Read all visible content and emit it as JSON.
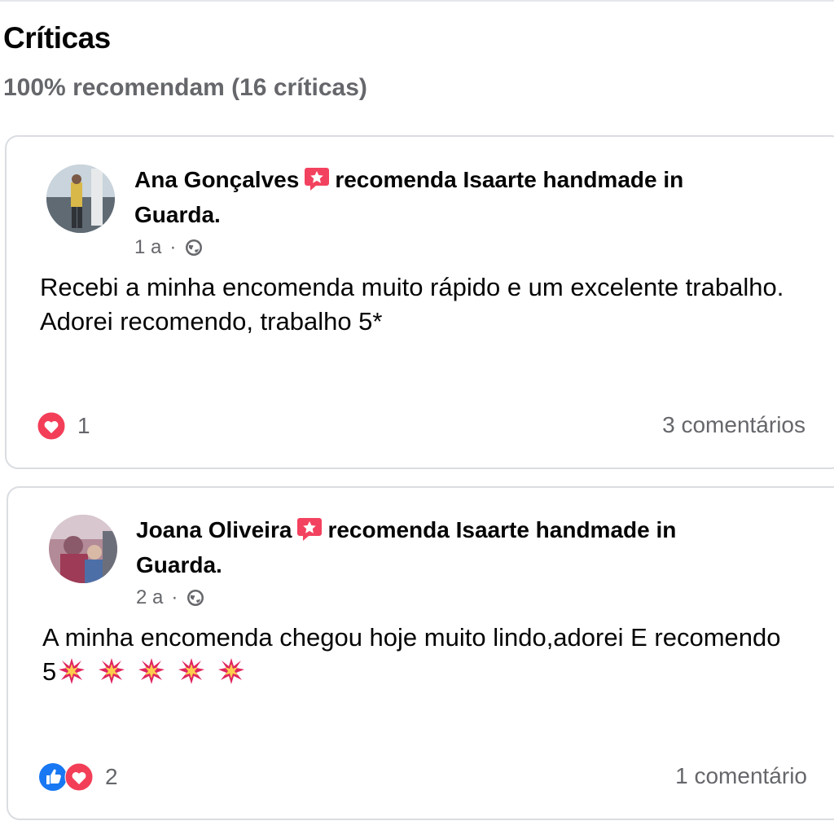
{
  "header": {
    "title": "Críticas",
    "summary": "100% recomendam (16 críticas)"
  },
  "reviews": [
    {
      "author": "Ana Gonçalves",
      "action": "recomenda Isaarte handmade in Guarda.",
      "time": "1 a",
      "separator": "·",
      "privacy_icon": "globe-icon",
      "text": "Recebi a minha encomenda muito rápido e um excelente trabalho. Adorei recomendo, trabalho 5*",
      "reactions": [
        "love-reaction-icon"
      ],
      "reaction_count": "1",
      "comments": "3 comentários"
    },
    {
      "author": "Joana Oliveira",
      "action": "recomenda Isaarte handmade in Guarda.",
      "time": "2 a",
      "separator": "·",
      "privacy_icon": "globe-icon",
      "text": "A minha encomenda chegou hoje muito lindo,adorei E recomendo 5",
      "sparkle_icons": [
        "sparkle-icon",
        "sparkle-icon",
        "sparkle-icon",
        "sparkle-icon",
        "sparkle-icon"
      ],
      "reactions": [
        "like-reaction-icon",
        "love-reaction-icon"
      ],
      "reaction_count": "2",
      "comments": "1 comentário"
    }
  ],
  "colors": {
    "love": "#f33e58",
    "like": "#1877f2",
    "recommend_badge": "#f3425f",
    "secondary_text": "#65676b",
    "card_border": "#dadde1"
  }
}
